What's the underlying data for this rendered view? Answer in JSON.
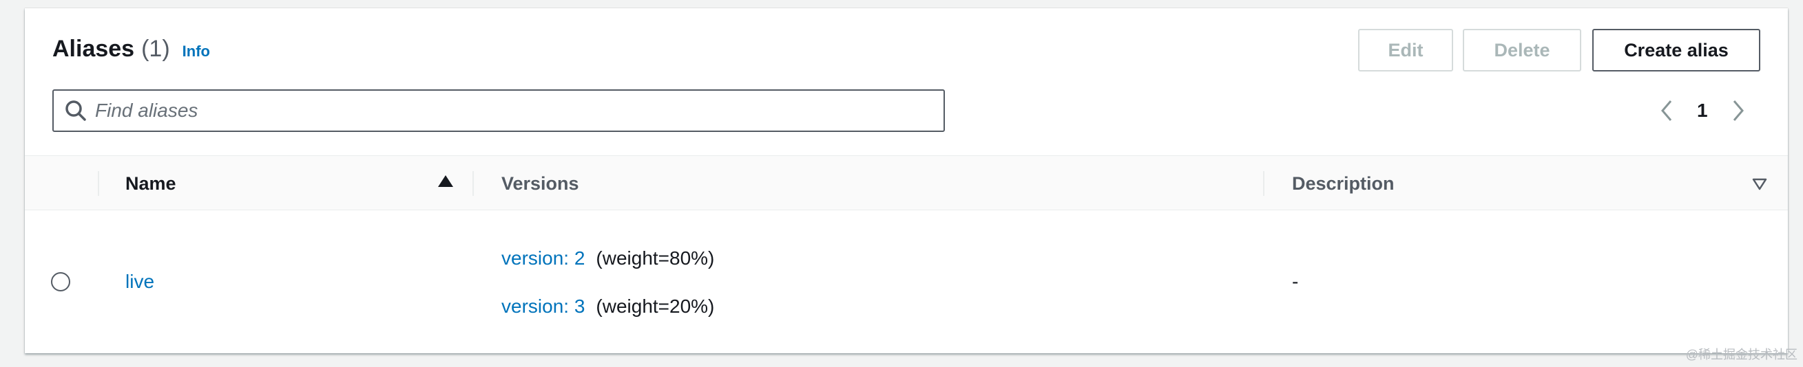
{
  "header": {
    "title": "Aliases",
    "count": "(1)",
    "info_label": "Info"
  },
  "actions": {
    "edit_label": "Edit",
    "delete_label": "Delete",
    "create_label": "Create alias"
  },
  "search": {
    "value": "",
    "placeholder": "Find aliases"
  },
  "pagination": {
    "current_page": "1"
  },
  "table": {
    "columns": [
      {
        "label": "Name",
        "sort": "ascending"
      },
      {
        "label": "Versions"
      },
      {
        "label": "Description",
        "sort": "descending"
      }
    ],
    "rows": [
      {
        "name": "live",
        "versions": [
          {
            "label": "version: 2",
            "weight": "(weight=80%)"
          },
          {
            "label": "version: 3",
            "weight": "(weight=20%)"
          }
        ],
        "description": "-"
      }
    ]
  },
  "watermark": "@稀土掘金技术社区",
  "colors": {
    "link": "#0073bb",
    "text": "#16191f",
    "muted": "#545b64",
    "disabled": "#aab7b8",
    "background": "#f2f3f3"
  }
}
